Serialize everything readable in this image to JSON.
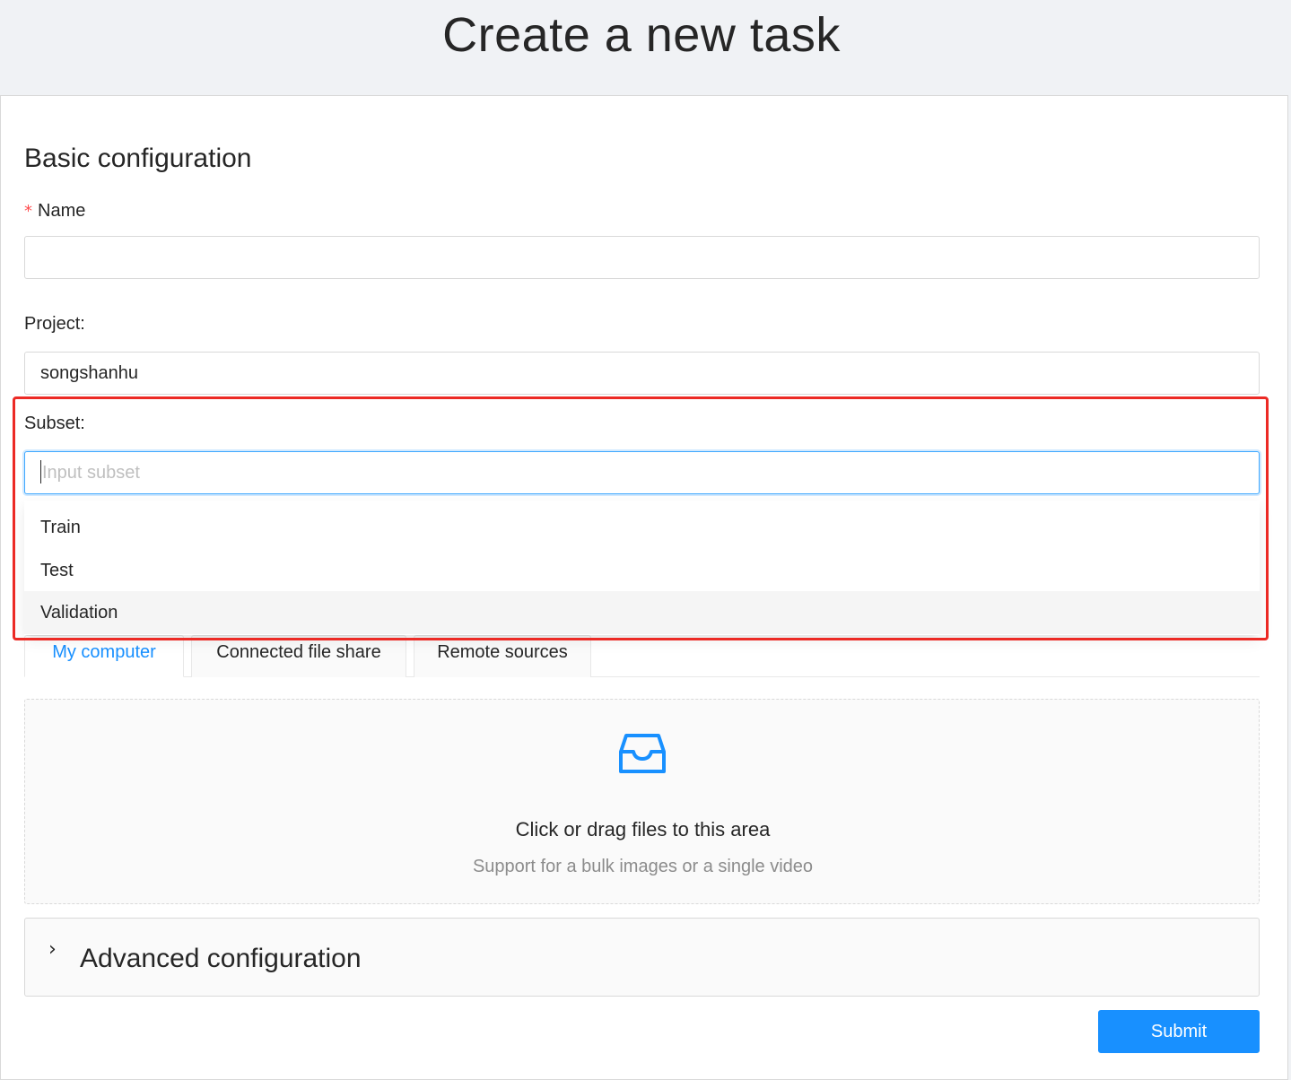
{
  "header": {
    "title": "Create a new task"
  },
  "basic": {
    "section_title": "Basic configuration",
    "name": {
      "required_mark": "*",
      "label": "Name",
      "value": ""
    },
    "project": {
      "label": "Project:",
      "value": "songshanhu"
    },
    "subset": {
      "label": "Subset:",
      "placeholder": "Input subset",
      "options": [
        "Train",
        "Test",
        "Validation"
      ],
      "highlighted_option": "Validation"
    }
  },
  "source_tabs": {
    "tabs": [
      "My computer",
      "Connected file share",
      "Remote sources"
    ],
    "active": "My computer"
  },
  "upload": {
    "icon": "inbox-icon",
    "text": "Click or drag files to this area",
    "hint": "Support for a bulk images or a single video"
  },
  "advanced": {
    "title": "Advanced configuration",
    "expanded": false
  },
  "actions": {
    "submit_label": "Submit"
  },
  "colors": {
    "primary": "#1890ff",
    "annotation_box": "#ec2a25",
    "required": "#ff4d4f"
  }
}
